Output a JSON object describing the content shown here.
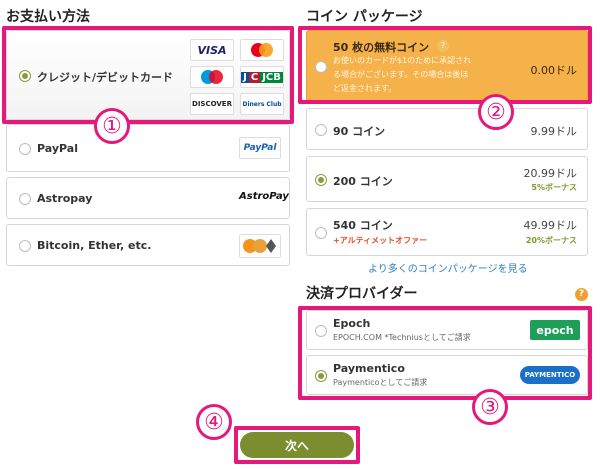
{
  "payment_methods": {
    "title": "お支払い方法",
    "credit_card_label": "クレジット/デビットカード",
    "card_logos": {
      "visa": "VISA",
      "jcb": "JCB",
      "discover": "DISCOVER",
      "diners": "Diners Club"
    },
    "paypal": {
      "label": "PayPal",
      "logo": "PayPal"
    },
    "astropay": {
      "label": "Astropay",
      "logo": "AstroPay"
    },
    "crypto": {
      "label": "Bitcoin, Ether, etc."
    }
  },
  "coin_packages": {
    "title": "コイン パッケージ",
    "free": {
      "label": "50 枚の無料コイン",
      "help": "?",
      "note_line1": "お使いのカードが$1のために承認され",
      "note_line2": "る場合がございます。その場合は後ほ",
      "note_line3": "ど返金されます。",
      "price": "0.00ドル"
    },
    "items": [
      {
        "label": "90 コイン",
        "price": "9.99ドル",
        "bonus": "",
        "promo": ""
      },
      {
        "label": "200 コイン",
        "price": "20.99ドル",
        "bonus": "5%ボーナス",
        "promo": ""
      },
      {
        "label": "540 コイン",
        "price": "49.99ドル",
        "bonus": "20%ボーナス",
        "promo": "+アルティメットオファー"
      }
    ],
    "more_link": "より多くのコインパッケージを見る"
  },
  "providers": {
    "title": "決済プロバイダー",
    "help": "?",
    "epoch": {
      "label": "Epoch",
      "sub": "EPOCH.COM *Techniusとしてご請求",
      "logo": "epoch"
    },
    "paymentico": {
      "label": "Paymentico",
      "sub": "Paymenticoとしてご請求",
      "logo": "PAYMENTICO"
    }
  },
  "next_button": "次へ",
  "annotations": {
    "n1": "①",
    "n2": "②",
    "n3": "③",
    "n4": "④"
  },
  "colors": {
    "accent": "#8a9a3c",
    "highlight": "#e5197c",
    "free_bg": "#f5b24a",
    "link": "#2a7fc1"
  }
}
